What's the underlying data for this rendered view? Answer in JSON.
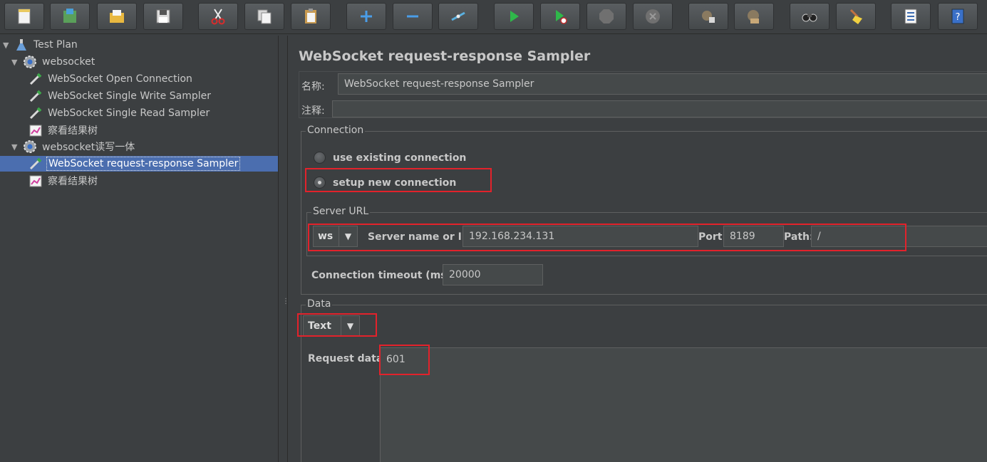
{
  "toolbar": {
    "buttons": [
      {
        "name": "new-icon"
      },
      {
        "name": "templates-icon"
      },
      {
        "name": "open-icon"
      },
      {
        "name": "save-icon"
      },
      {
        "name": "cut-icon"
      },
      {
        "name": "copy-icon"
      },
      {
        "name": "paste-icon"
      },
      {
        "name": "expand-icon"
      },
      {
        "name": "collapse-icon"
      },
      {
        "name": "toggle-icon"
      },
      {
        "name": "start-icon"
      },
      {
        "name": "start-no-pauses-icon"
      },
      {
        "name": "stop-icon"
      },
      {
        "name": "shutdown-icon"
      },
      {
        "name": "clear-icon"
      },
      {
        "name": "clear-all-icon"
      },
      {
        "name": "search-icon"
      },
      {
        "name": "reset-search-icon"
      },
      {
        "name": "function-helper-icon"
      },
      {
        "name": "help-icon"
      }
    ]
  },
  "tree": {
    "items": [
      {
        "label": "Test Plan",
        "icon": "flask-icon"
      },
      {
        "label": "websocket",
        "icon": "gear-icon"
      },
      {
        "label": "WebSocket Open Connection",
        "icon": "pipette-icon"
      },
      {
        "label": "WebSocket Single Write Sampler",
        "icon": "pipette-icon"
      },
      {
        "label": "WebSocket Single Read Sampler",
        "icon": "pipette-icon"
      },
      {
        "label": "察看结果树",
        "icon": "chart-icon"
      },
      {
        "label": "websocket读写一体",
        "icon": "gear-icon"
      },
      {
        "label": "WebSocket request-response Sampler",
        "icon": "pipette-icon"
      },
      {
        "label": "察看结果树",
        "icon": "chart-icon"
      }
    ]
  },
  "main": {
    "title": "WebSocket request-response Sampler",
    "name_label": "名称:",
    "name_value": "WebSocket request-response Sampler",
    "comment_label": "注释:",
    "comment_value": "",
    "connection": {
      "legend": "Connection",
      "options": [
        "use existing connection",
        "setup new connection"
      ],
      "selected": "setup new connection"
    },
    "server_url": {
      "legend": "Server URL",
      "protocol": "ws",
      "server_label": "Server name or IP:",
      "server_value": "192.168.234.131",
      "port_label": "Port:",
      "port_value": "8189",
      "path_label": "Path:",
      "path_value": "/"
    },
    "timeout": {
      "label": "Connection timeout (ms):",
      "value": "20000"
    },
    "data": {
      "legend": "Data",
      "type": "Text",
      "request_label": "Request data:",
      "request_value": "601"
    },
    "highlight_color": "#e3222b"
  }
}
